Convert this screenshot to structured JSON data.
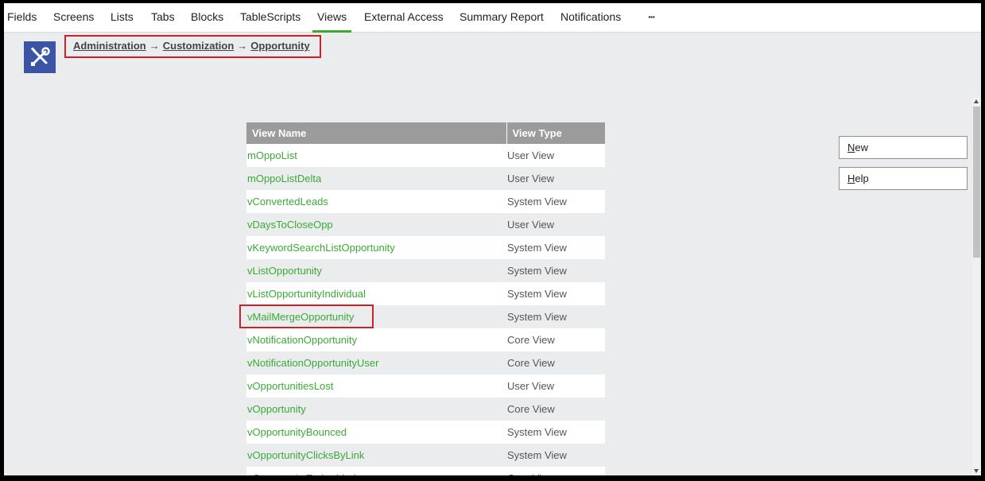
{
  "tabs": [
    {
      "label": "Fields"
    },
    {
      "label": "Screens"
    },
    {
      "label": "Lists"
    },
    {
      "label": "Tabs"
    },
    {
      "label": "Blocks"
    },
    {
      "label": "TableScripts"
    },
    {
      "label": "Views",
      "active": true
    },
    {
      "label": "External Access"
    },
    {
      "label": "Summary Report"
    },
    {
      "label": "Notifications"
    },
    {
      "label": "···"
    }
  ],
  "breadcrumb": {
    "items": [
      "Administration",
      "Customization",
      "Opportunity"
    ],
    "separator": "→"
  },
  "table": {
    "headers": [
      "View Name",
      "View Type"
    ],
    "rows": [
      [
        "mOppoList",
        "User View"
      ],
      [
        "mOppoListDelta",
        "User View"
      ],
      [
        "vConvertedLeads",
        "System View"
      ],
      [
        "vDaysToCloseOpp",
        "User View"
      ],
      [
        "vKeywordSearchListOpportunity",
        "System View"
      ],
      [
        "vListOpportunity",
        "System View"
      ],
      [
        "vListOpportunityIndividual",
        "System View"
      ],
      [
        "vMailMergeOpportunity",
        "System View"
      ],
      [
        "vNotificationOpportunity",
        "Core View"
      ],
      [
        "vNotificationOpportunityUser",
        "Core View"
      ],
      [
        "vOpportunitiesLost",
        "User View"
      ],
      [
        "vOpportunity",
        "Core View"
      ],
      [
        "vOpportunityBounced",
        "System View"
      ],
      [
        "vOpportunityClicksByLink",
        "System View"
      ],
      [
        "vOpportunityEmbedded",
        "Core View"
      ]
    ]
  },
  "actions": {
    "new_label_first": "N",
    "new_label_rest": "ew",
    "help_label_first": "H",
    "help_label_rest": "elp"
  },
  "icons": {
    "admin": "admin-tools-icon"
  },
  "colors": {
    "accent": "#3aaa35",
    "icon_bg": "#3b55a4",
    "highlight": "#d32027",
    "header_bg": "#9b9b9b"
  }
}
